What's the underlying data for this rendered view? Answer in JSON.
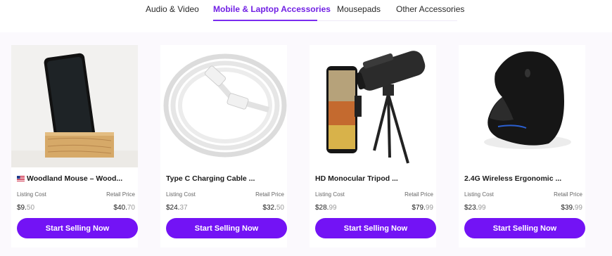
{
  "tabs": [
    {
      "label": "Audio & Video",
      "active": false
    },
    {
      "label": "Mobile & Laptop Accessories",
      "active": true
    },
    {
      "label": "Mousepads",
      "active": false
    },
    {
      "label": "Other Accessories",
      "active": false
    }
  ],
  "labels": {
    "listing_cost": "Listing Cost",
    "retail_price": "Retail Price",
    "button": "Start Selling Now"
  },
  "products": [
    {
      "title": "Woodland Mouse – Wood...",
      "flag": "us-flag-icon",
      "listing_major": "$9.",
      "listing_minor": "50",
      "retail_major": "$40.",
      "retail_minor": "70",
      "image": "phone-wood-stand"
    },
    {
      "title": "Type C Charging Cable ...",
      "listing_major": "$24.",
      "listing_minor": "37",
      "retail_major": "$32.",
      "retail_minor": "50",
      "image": "coiled-white-cable"
    },
    {
      "title": "HD Monocular Tripod  ...",
      "listing_major": "$28.",
      "listing_minor": "99",
      "retail_major": "$79.",
      "retail_minor": "99",
      "image": "monocular-phone-tripod"
    },
    {
      "title": "2.4G Wireless Ergonomic ...",
      "listing_major": "$23.",
      "listing_minor": "99",
      "retail_major": "$39.",
      "retail_minor": "99",
      "image": "vertical-ergonomic-mouse"
    }
  ],
  "colors": {
    "accent": "#7313f5",
    "active_tab": "#7120e4"
  }
}
